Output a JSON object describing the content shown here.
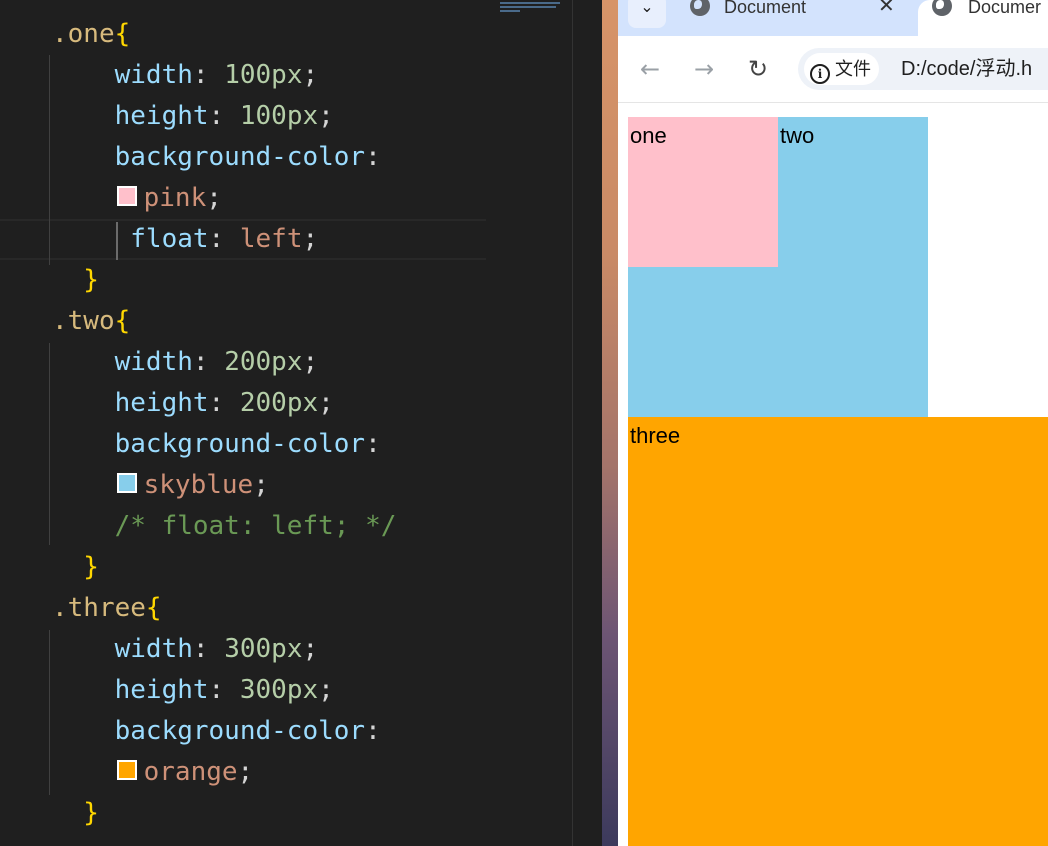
{
  "editor": {
    "lines": [
      [
        {
          "t": ".one",
          "c": "sel"
        },
        {
          "t": "{",
          "c": "brace"
        }
      ],
      [
        {
          "t": "    width",
          "c": "prop"
        },
        {
          "t": ": ",
          "c": "punc"
        },
        {
          "t": "100px",
          "c": "num"
        },
        {
          "t": ";",
          "c": "punc"
        }
      ],
      [
        {
          "t": "    height",
          "c": "prop"
        },
        {
          "t": ": ",
          "c": "punc"
        },
        {
          "t": "100px",
          "c": "num"
        },
        {
          "t": ";",
          "c": "punc"
        }
      ],
      [
        {
          "t": "    background-color",
          "c": "prop"
        },
        {
          "t": ":",
          "c": "punc"
        }
      ],
      [
        {
          "t": "    ",
          "c": "punc"
        },
        {
          "swatch": "#ffc0cb"
        },
        {
          "t": "pink",
          "c": "str"
        },
        {
          "t": ";",
          "c": "punc"
        }
      ],
      [
        {
          "t": "     float",
          "c": "prop"
        },
        {
          "t": ": ",
          "c": "punc"
        },
        {
          "t": "left",
          "c": "str"
        },
        {
          "t": ";",
          "c": "punc"
        }
      ],
      [
        {
          "t": "  }",
          "c": "brace"
        }
      ],
      [
        {
          "t": ".two",
          "c": "sel"
        },
        {
          "t": "{",
          "c": "brace"
        }
      ],
      [
        {
          "t": "    width",
          "c": "prop"
        },
        {
          "t": ": ",
          "c": "punc"
        },
        {
          "t": "200px",
          "c": "num"
        },
        {
          "t": ";",
          "c": "punc"
        }
      ],
      [
        {
          "t": "    height",
          "c": "prop"
        },
        {
          "t": ": ",
          "c": "punc"
        },
        {
          "t": "200px",
          "c": "num"
        },
        {
          "t": ";",
          "c": "punc"
        }
      ],
      [
        {
          "t": "    background-color",
          "c": "prop"
        },
        {
          "t": ":",
          "c": "punc"
        }
      ],
      [
        {
          "t": "    ",
          "c": "punc"
        },
        {
          "swatch": "#87ceeb"
        },
        {
          "t": "skyblue",
          "c": "str"
        },
        {
          "t": ";",
          "c": "punc"
        }
      ],
      [
        {
          "t": "    /* float: left; */",
          "c": "comment"
        }
      ],
      [
        {
          "t": "  }",
          "c": "brace"
        }
      ],
      [
        {
          "t": ".three",
          "c": "sel"
        },
        {
          "t": "{",
          "c": "brace"
        }
      ],
      [
        {
          "t": "    width",
          "c": "prop"
        },
        {
          "t": ": ",
          "c": "punc"
        },
        {
          "t": "300px",
          "c": "num"
        },
        {
          "t": ";",
          "c": "punc"
        }
      ],
      [
        {
          "t": "    height",
          "c": "prop"
        },
        {
          "t": ": ",
          "c": "punc"
        },
        {
          "t": "300px",
          "c": "num"
        },
        {
          "t": ";",
          "c": "punc"
        }
      ],
      [
        {
          "t": "    background-color",
          "c": "prop"
        },
        {
          "t": ":",
          "c": "punc"
        }
      ],
      [
        {
          "t": "    ",
          "c": "punc"
        },
        {
          "swatch": "#ffa500"
        },
        {
          "t": "orange",
          "c": "str"
        },
        {
          "t": ";",
          "c": "punc"
        }
      ],
      [
        {
          "t": "  }",
          "c": "brace"
        }
      ]
    ],
    "current_line_index": 5
  },
  "browser": {
    "tab_list_icon": "chevron-down-icon",
    "tabs": [
      {
        "title": "Document",
        "icon": "globe-icon",
        "close": "✕"
      },
      {
        "title": "Documer",
        "icon": "globe-icon"
      }
    ],
    "toolbar": {
      "back_icon": "arrow-left-icon",
      "forward_icon": "arrow-right-icon",
      "reload_icon": "reload-icon",
      "site_chip_label": "文件",
      "url": "D:/code/浮动.h"
    },
    "page": {
      "boxes": {
        "one": {
          "label": "one",
          "color": "#ffc0cb"
        },
        "two": {
          "label": "two",
          "color": "#87ceeb"
        },
        "three": {
          "label": "three",
          "color": "#ffa500"
        }
      }
    }
  }
}
